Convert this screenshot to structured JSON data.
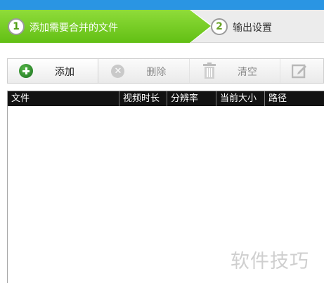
{
  "steps": [
    {
      "number": "1",
      "label": "添加需要合并的文件"
    },
    {
      "number": "2",
      "label": "输出设置"
    }
  ],
  "toolbar": {
    "add_label": "添加",
    "delete_label": "删除",
    "clear_label": "清空"
  },
  "icons": {
    "add": "plus-circle-icon",
    "delete": "x-circle-icon",
    "clear": "trash-icon",
    "edit": "edit-icon"
  },
  "colors": {
    "active_step": "#7bd12a",
    "header_bg": "#121212",
    "top_strip": "#2a95e3"
  },
  "table": {
    "columns": [
      "文件",
      "视频时长",
      "分辨率",
      "当前大小",
      "路径"
    ],
    "rows": []
  },
  "watermark": "软件技巧"
}
